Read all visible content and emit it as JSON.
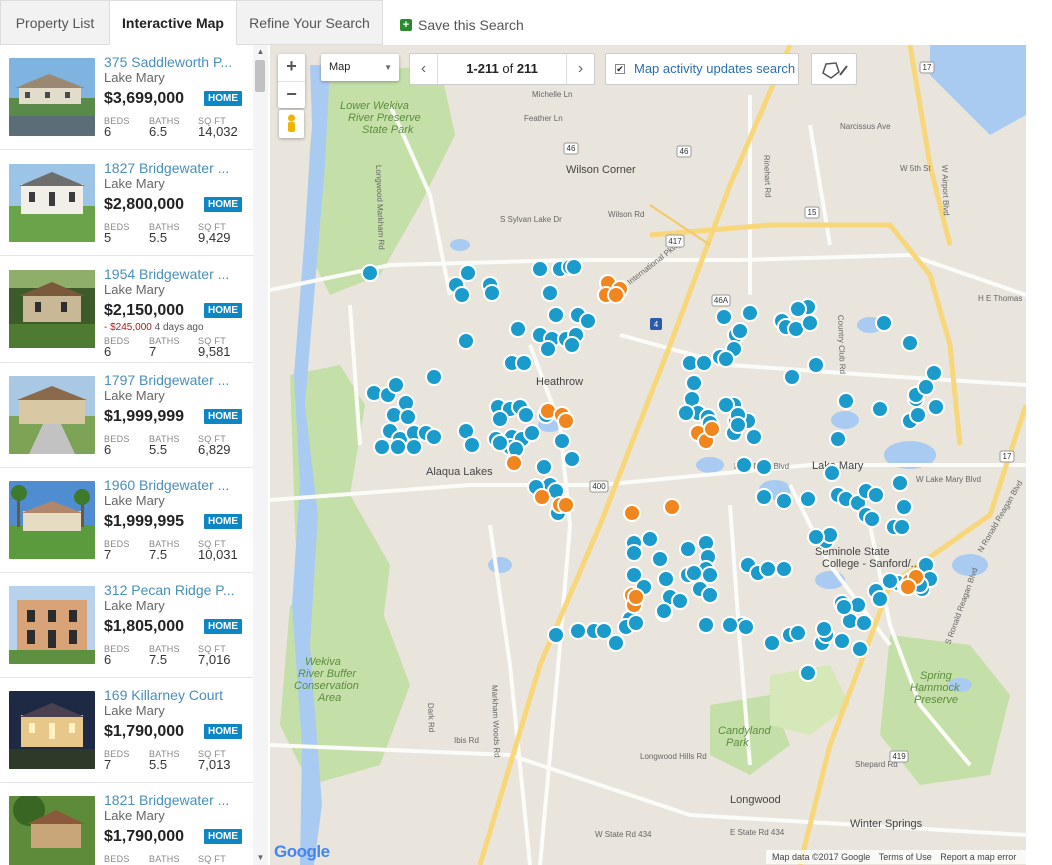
{
  "tabs": [
    {
      "label": "Property List"
    },
    {
      "label": "Interactive Map"
    },
    {
      "label": "Refine Your Search"
    }
  ],
  "save_search": {
    "label": "Save this Search"
  },
  "listings": [
    {
      "address": "375 Saddleworth P...",
      "city": "Lake Mary",
      "price": "$3,699,000",
      "badge": "HOME",
      "beds": "6",
      "baths": "6.5",
      "sqft": "14,032"
    },
    {
      "address": "1827 Bridgewater ...",
      "city": "Lake Mary",
      "price": "$2,800,000",
      "badge": "HOME",
      "beds": "5",
      "baths": "5.5",
      "sqft": "9,429"
    },
    {
      "address": "1954 Bridgewater ...",
      "city": "Lake Mary",
      "price": "$2,150,000",
      "badge": "HOME",
      "reduction": "- $245,000",
      "reduced_when": "4 days ago",
      "beds": "6",
      "baths": "7",
      "sqft": "9,581"
    },
    {
      "address": "1797 Bridgewater ...",
      "city": "Lake Mary",
      "price": "$1,999,999",
      "badge": "HOME",
      "beds": "6",
      "baths": "5.5",
      "sqft": "6,829"
    },
    {
      "address": "1960 Bridgewater ...",
      "city": "Lake Mary",
      "price": "$1,999,995",
      "badge": "HOME",
      "beds": "7",
      "baths": "7.5",
      "sqft": "10,031"
    },
    {
      "address": "312 Pecan Ridge P...",
      "city": "Lake Mary",
      "price": "$1,805,000",
      "badge": "HOME",
      "beds": "6",
      "baths": "7.5",
      "sqft": "7,016"
    },
    {
      "address": "169 Killarney Court",
      "city": "Lake Mary",
      "price": "$1,790,000",
      "badge": "HOME",
      "beds": "7",
      "baths": "5.5",
      "sqft": "7,013"
    },
    {
      "address": "1821 Bridgewater ...",
      "city": "Lake Mary",
      "price": "$1,790,000",
      "badge": "HOME",
      "beds": "",
      "baths": "",
      "sqft": ""
    }
  ],
  "stat_labels": {
    "beds": "BEDS",
    "baths": "BATHS",
    "sqft": "SQ FT"
  },
  "map": {
    "zoom_in": "+",
    "zoom_out": "−",
    "map_type": "Map",
    "pager_range": "1-211",
    "pager_of": "of",
    "pager_total": "211",
    "activity_label": "Map activity updates search",
    "activity_checked": "✔",
    "logo": "Google",
    "attribution": {
      "data": "Map data ©2017 Google",
      "terms": "Terms of Use",
      "report": "Report a map error"
    },
    "labels": [
      "Lower Wekiva",
      "River Preserve",
      "State Park",
      "Wilson Corner",
      "Heathrow",
      "Alaqua Lakes",
      "Lake Mary",
      "Seminole State",
      "College - Sanford/...",
      "Wekiva",
      "River Buffer",
      "Conservation",
      "Area",
      "Candyland",
      "Park",
      "Spring",
      "Hammock",
      "Preserve",
      "Longwood",
      "Winter Springs",
      "Wilson Rd",
      "S Sylvan Lake Dr",
      "International Pkwy",
      "Country Club Rd",
      "H E Thomas",
      "W Lake Mary Blvd",
      "Lake Mary Blvd",
      "Longwood Hills Rd",
      "W State Rd 434",
      "E State Rd 434",
      "Markham Woods Rd",
      "Longwood Markham Rd",
      "S Ronald Reagan Blvd",
      "N Ronald Reagan Blvd",
      "Rinehart Rd",
      "Narcissus Ave",
      "W 5th St",
      "W Airport Blvd",
      "Michelle Ln",
      "Feather Ln",
      "Shepard Rd",
      "Ibis Rd",
      "Dark Rd",
      "46",
      "46A",
      "417",
      "15",
      "4",
      "400",
      "17",
      "419"
    ],
    "marker_colors": {
      "listing": "#1a9bcc",
      "new": "#f2861e"
    }
  }
}
